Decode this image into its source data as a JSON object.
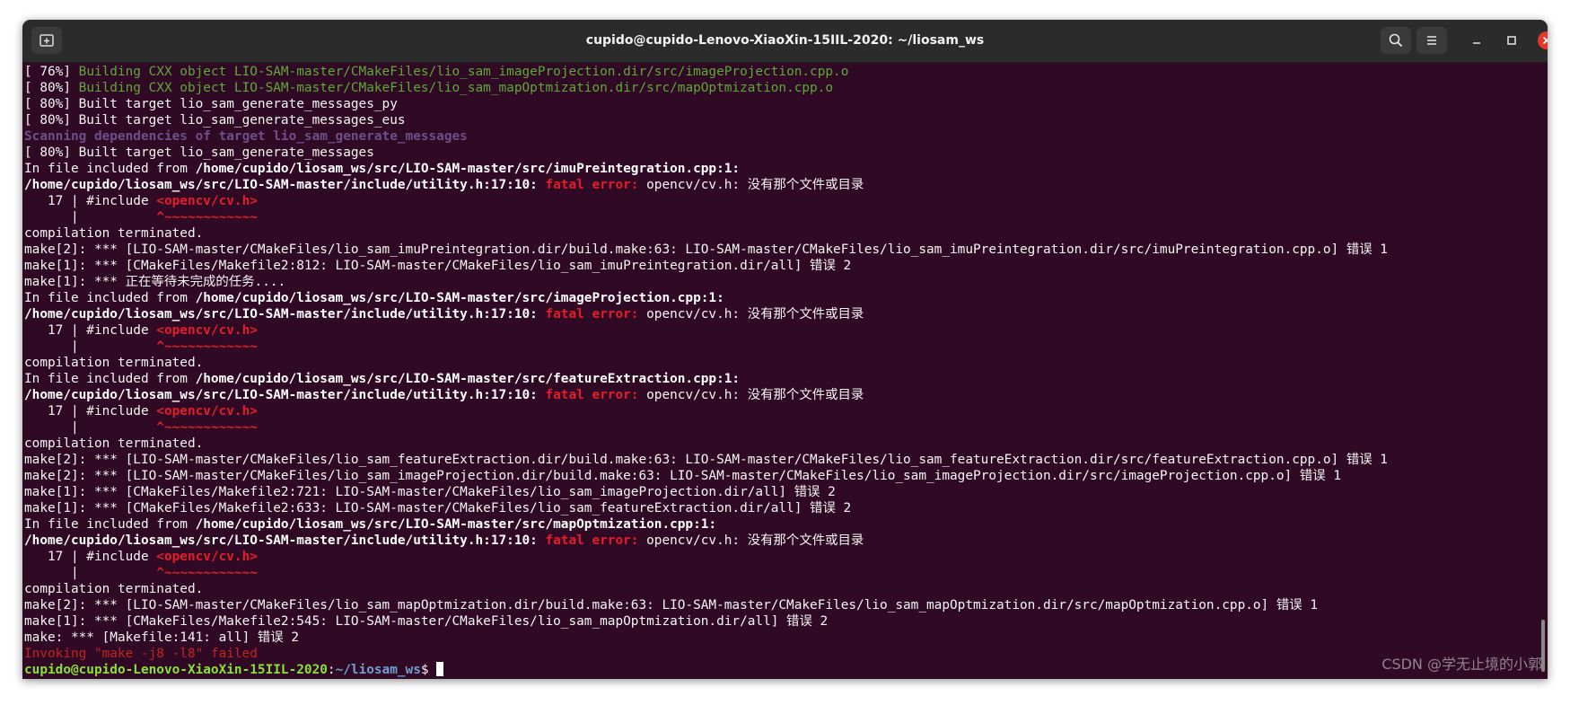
{
  "window": {
    "title": "cupido@cupido-Lenovo-XiaoXin-15IIL-2020: ~/liosam_ws",
    "icons": {
      "new_tab": "new-tab-icon",
      "search": "search-icon",
      "menu": "hamburger-menu-icon",
      "minimize": "minimize-icon",
      "maximize": "maximize-icon",
      "close": "close-icon"
    },
    "close_color": "#e2392d"
  },
  "terminal": {
    "background": "#300a24",
    "lines": [
      [
        {
          "t": "[ 76%] ",
          "c": "w"
        },
        {
          "t": "Building CXX object LIO-SAM-master/CMakeFiles/lio_sam_imageProjection.dir/src/imageProjection.cpp.o",
          "c": "g"
        }
      ],
      [
        {
          "t": "[ 80%] ",
          "c": "w"
        },
        {
          "t": "Building CXX object LIO-SAM-master/CMakeFiles/lio_sam_mapOptmization.dir/src/mapOptmization.cpp.o",
          "c": "g"
        }
      ],
      [
        {
          "t": "[ 80%] Built target lio_sam_generate_messages_py",
          "c": "w"
        }
      ],
      [
        {
          "t": "[ 80%] Built target lio_sam_generate_messages_eus",
          "c": "w"
        }
      ],
      [
        {
          "t": "Scanning dependencies of target lio_sam_generate_messages",
          "c": "pu"
        }
      ],
      [
        {
          "t": "[ 80%] Built target lio_sam_generate_messages",
          "c": "w"
        }
      ],
      [
        {
          "t": "In file included from ",
          "c": "w"
        },
        {
          "t": "/home/cupido/liosam_ws/src/LIO-SAM-master/src/imuPreintegration.cpp:1:",
          "c": "b"
        }
      ],
      [
        {
          "t": "/home/cupido/liosam_ws/src/LIO-SAM-master/include/utility.h:17:10: ",
          "c": "b"
        },
        {
          "t": "fatal error: ",
          "c": "r"
        },
        {
          "t": "opencv/cv.h: 没有那个文件或目录",
          "c": "w"
        }
      ],
      [
        {
          "t": "   17 | #include ",
          "c": "w"
        },
        {
          "t": "<opencv/cv.h>",
          "c": "r"
        }
      ],
      [
        {
          "t": "      |          ",
          "c": "w"
        },
        {
          "t": "^~~~~~~~~~~~~",
          "c": "r"
        }
      ],
      [
        {
          "t": "compilation terminated.",
          "c": "w"
        }
      ],
      [
        {
          "t": "make[2]: *** [LIO-SAM-master/CMakeFiles/lio_sam_imuPreintegration.dir/build.make:63: LIO-SAM-master/CMakeFiles/lio_sam_imuPreintegration.dir/src/imuPreintegration.cpp.o] 错误 1",
          "c": "w"
        }
      ],
      [
        {
          "t": "make[1]: *** [CMakeFiles/Makefile2:812: LIO-SAM-master/CMakeFiles/lio_sam_imuPreintegration.dir/all] 错误 2",
          "c": "w"
        }
      ],
      [
        {
          "t": "make[1]: *** 正在等待未完成的任务....",
          "c": "w"
        }
      ],
      [
        {
          "t": "In file included from ",
          "c": "w"
        },
        {
          "t": "/home/cupido/liosam_ws/src/LIO-SAM-master/src/imageProjection.cpp:1:",
          "c": "b"
        }
      ],
      [
        {
          "t": "/home/cupido/liosam_ws/src/LIO-SAM-master/include/utility.h:17:10: ",
          "c": "b"
        },
        {
          "t": "fatal error: ",
          "c": "r"
        },
        {
          "t": "opencv/cv.h: 没有那个文件或目录",
          "c": "w"
        }
      ],
      [
        {
          "t": "   17 | #include ",
          "c": "w"
        },
        {
          "t": "<opencv/cv.h>",
          "c": "r"
        }
      ],
      [
        {
          "t": "      |          ",
          "c": "w"
        },
        {
          "t": "^~~~~~~~~~~~~",
          "c": "r"
        }
      ],
      [
        {
          "t": "compilation terminated.",
          "c": "w"
        }
      ],
      [
        {
          "t": "In file included from ",
          "c": "w"
        },
        {
          "t": "/home/cupido/liosam_ws/src/LIO-SAM-master/src/featureExtraction.cpp:1:",
          "c": "b"
        }
      ],
      [
        {
          "t": "/home/cupido/liosam_ws/src/LIO-SAM-master/include/utility.h:17:10: ",
          "c": "b"
        },
        {
          "t": "fatal error: ",
          "c": "r"
        },
        {
          "t": "opencv/cv.h: 没有那个文件或目录",
          "c": "w"
        }
      ],
      [
        {
          "t": "   17 | #include ",
          "c": "w"
        },
        {
          "t": "<opencv/cv.h>",
          "c": "r"
        }
      ],
      [
        {
          "t": "      |          ",
          "c": "w"
        },
        {
          "t": "^~~~~~~~~~~~~",
          "c": "r"
        }
      ],
      [
        {
          "t": "compilation terminated.",
          "c": "w"
        }
      ],
      [
        {
          "t": "make[2]: *** [LIO-SAM-master/CMakeFiles/lio_sam_featureExtraction.dir/build.make:63: LIO-SAM-master/CMakeFiles/lio_sam_featureExtraction.dir/src/featureExtraction.cpp.o] 错误 1",
          "c": "w"
        }
      ],
      [
        {
          "t": "make[2]: *** [LIO-SAM-master/CMakeFiles/lio_sam_imageProjection.dir/build.make:63: LIO-SAM-master/CMakeFiles/lio_sam_imageProjection.dir/src/imageProjection.cpp.o] 错误 1",
          "c": "w"
        }
      ],
      [
        {
          "t": "make[1]: *** [CMakeFiles/Makefile2:721: LIO-SAM-master/CMakeFiles/lio_sam_imageProjection.dir/all] 错误 2",
          "c": "w"
        }
      ],
      [
        {
          "t": "make[1]: *** [CMakeFiles/Makefile2:633: LIO-SAM-master/CMakeFiles/lio_sam_featureExtraction.dir/all] 错误 2",
          "c": "w"
        }
      ],
      [
        {
          "t": "In file included from ",
          "c": "w"
        },
        {
          "t": "/home/cupido/liosam_ws/src/LIO-SAM-master/src/mapOptmization.cpp:1:",
          "c": "b"
        }
      ],
      [
        {
          "t": "/home/cupido/liosam_ws/src/LIO-SAM-master/include/utility.h:17:10: ",
          "c": "b"
        },
        {
          "t": "fatal error: ",
          "c": "r"
        },
        {
          "t": "opencv/cv.h: 没有那个文件或目录",
          "c": "w"
        }
      ],
      [
        {
          "t": "   17 | #include ",
          "c": "w"
        },
        {
          "t": "<opencv/cv.h>",
          "c": "r"
        }
      ],
      [
        {
          "t": "      |          ",
          "c": "w"
        },
        {
          "t": "^~~~~~~~~~~~~",
          "c": "r"
        }
      ],
      [
        {
          "t": "compilation terminated.",
          "c": "w"
        }
      ],
      [
        {
          "t": "make[2]: *** [LIO-SAM-master/CMakeFiles/lio_sam_mapOptmization.dir/build.make:63: LIO-SAM-master/CMakeFiles/lio_sam_mapOptmization.dir/src/mapOptmization.cpp.o] 错误 1",
          "c": "w"
        }
      ],
      [
        {
          "t": "make[1]: *** [CMakeFiles/Makefile2:545: LIO-SAM-master/CMakeFiles/lio_sam_mapOptmization.dir/all] 错误 2",
          "c": "w"
        }
      ],
      [
        {
          "t": "make: *** [Makefile:141: all] 错误 2",
          "c": "w"
        }
      ],
      [
        {
          "t": "Invoking \"make -j8 -l8\" failed",
          "c": "dr"
        }
      ],
      [
        {
          "t": "cupido@cupido-Lenovo-XiaoXin-15IIL-2020",
          "c": "pg"
        },
        {
          "t": ":",
          "c": "w"
        },
        {
          "t": "~/liosam_ws",
          "c": "pb"
        },
        {
          "t": "$ ",
          "c": "w"
        }
      ]
    ]
  },
  "watermark": "CSDN @学无止境的小郭"
}
